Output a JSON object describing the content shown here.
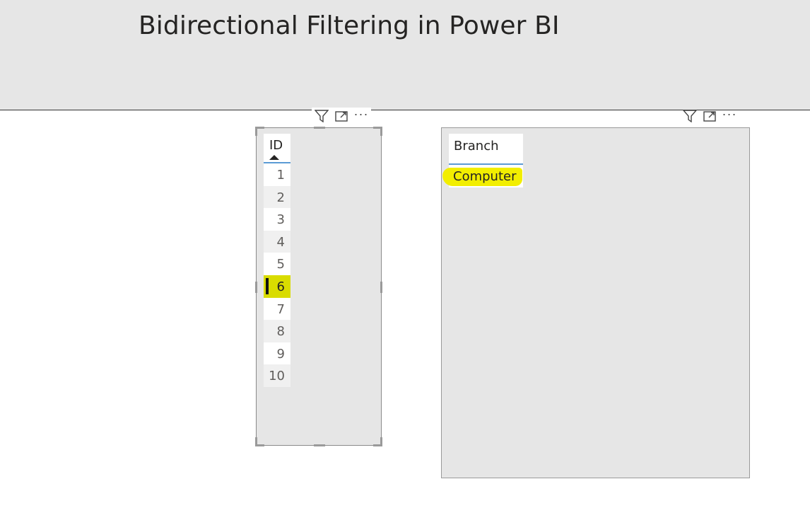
{
  "banner": {
    "title": "Bidirectional Filtering in Power BI"
  },
  "id_visual": {
    "icons": [
      "filter-icon",
      "focus-mode-icon",
      "more-options-icon"
    ],
    "column_header": "ID",
    "sort": "ascending",
    "rows": [
      "1",
      "2",
      "3",
      "4",
      "5",
      "6",
      "7",
      "8",
      "9",
      "10"
    ],
    "selected_row": "6"
  },
  "branch_visual": {
    "icons": [
      "filter-icon",
      "focus-mode-icon",
      "more-options-icon"
    ],
    "column_header": "Branch",
    "rows": [
      "Computer"
    ]
  },
  "colors": {
    "canvas_bg": "#e6e6e6",
    "header_underline": "#5b9bd5",
    "selection": "#d9dc00",
    "highlight": "#f2ee00"
  }
}
